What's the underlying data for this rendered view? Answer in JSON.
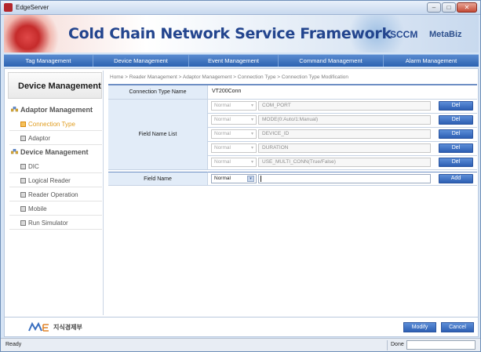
{
  "window": {
    "title": "EdgeServer",
    "minimize_glyph": "–",
    "maximize_glyph": "□",
    "close_glyph": "✕"
  },
  "banner": {
    "title": "Cold Chain Network Service Framework",
    "brand_scm": "SCCM",
    "brand_metabiz": "MetaBiz"
  },
  "menu": {
    "items": [
      {
        "label": "Tag Management"
      },
      {
        "label": "Device Management"
      },
      {
        "label": "Event Management"
      },
      {
        "label": "Command Management"
      },
      {
        "label": "Alarm Management"
      }
    ]
  },
  "sidebar": {
    "header": "Device Management",
    "groups": [
      {
        "label": "Adaptor Management",
        "items": [
          {
            "label": "Connection Type",
            "active": true
          },
          {
            "label": "Adaptor",
            "active": false
          }
        ]
      },
      {
        "label": "Device Management",
        "items": [
          {
            "label": "DIC",
            "active": false
          },
          {
            "label": "Logical Reader",
            "active": false
          },
          {
            "label": "Reader Operation",
            "active": false
          },
          {
            "label": "Mobile",
            "active": false
          },
          {
            "label": "Run Simulator",
            "active": false
          }
        ]
      }
    ]
  },
  "breadcrumb": "Home > Reader Management > Adaptor Management > Connection Type > Connection Type Modification",
  "form": {
    "connection_type_label": "Connection Type Name",
    "connection_type_value": "VT200Conn",
    "field_name_list_label": "Field Name List",
    "fields": [
      {
        "type": "Normal",
        "name": "COM_PORT",
        "button": "Del"
      },
      {
        "type": "Normal",
        "name": "MODE(0:Auto/1:Manual)",
        "button": "Del"
      },
      {
        "type": "Normal",
        "name": "DEVICE_ID",
        "button": "Del"
      },
      {
        "type": "Normal",
        "name": "DURATION",
        "button": "Del"
      },
      {
        "type": "Normal",
        "name": "USE_MULTI_CONN(True/False)",
        "button": "Del"
      }
    ],
    "field_name_label": "Field Name",
    "new_field": {
      "type": "Normal",
      "name": "",
      "button": "Add"
    }
  },
  "footer": {
    "logo_text": "지식경제부",
    "modify_label": "Modify",
    "cancel_label": "Cancel"
  },
  "status": {
    "left": "Ready",
    "right": "Done"
  }
}
